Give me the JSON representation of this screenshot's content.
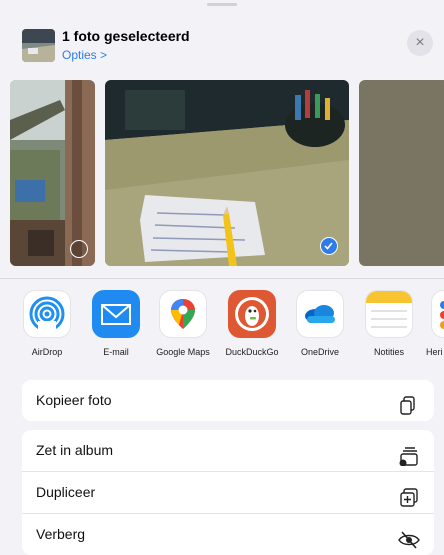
{
  "header": {
    "title": "1 foto geselecteerd",
    "options_label": "Opties >",
    "close_glyph": "×"
  },
  "photos": {
    "selected_count": 1
  },
  "apps": [
    {
      "label": "AirDrop",
      "icon": "airdrop-icon"
    },
    {
      "label": "E-mail",
      "icon": "mail-icon"
    },
    {
      "label": "Google Maps",
      "icon": "google-maps-icon"
    },
    {
      "label": "DuckDuckGo",
      "icon": "duckduckgo-icon"
    },
    {
      "label": "OneDrive",
      "icon": "onedrive-icon"
    },
    {
      "label": "Notities",
      "icon": "notes-icon"
    },
    {
      "label": "Heri",
      "icon": "reminders-icon"
    }
  ],
  "actions": {
    "copy_photo": "Kopieer foto",
    "add_to_album": "Zet in album",
    "duplicate": "Dupliceer",
    "hide": "Verberg"
  },
  "colors": {
    "accent": "#2f7bea",
    "background": "#f2f2f7"
  }
}
